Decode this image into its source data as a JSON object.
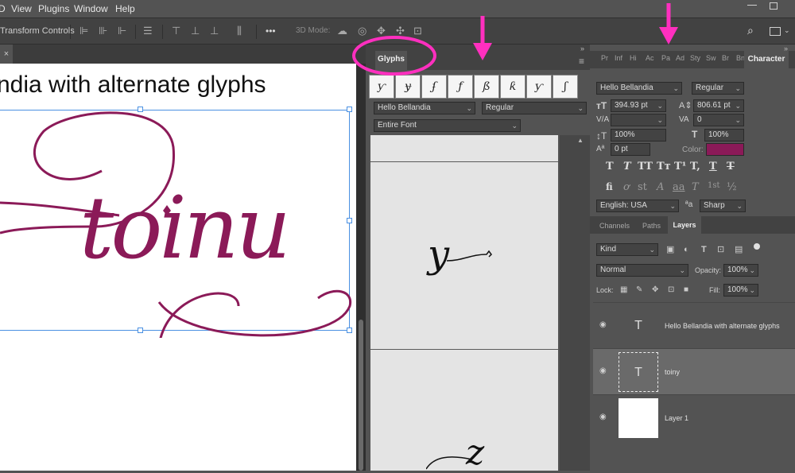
{
  "menubar": {
    "items": [
      "View",
      "Plugins",
      "Window",
      "Help"
    ],
    "partial": "D"
  },
  "options_bar": {
    "label": "Transform Controls",
    "more": "•••",
    "mode_label": "3D Mode:"
  },
  "document": {
    "tab_close": "×",
    "title_text": "ndia with alternate glyphs",
    "art_text": "toinu"
  },
  "glyphs": {
    "tab_label": "Glyphs",
    "recent": [
      "ƴ",
      "ɏ",
      "ʄ",
      "ƒ",
      "ß",
      "ƙ",
      "ƴ",
      "ʃ"
    ],
    "font": "Hello Bellandia",
    "style": "Regular",
    "filter": "Entire Font",
    "glyph_1": "y",
    "glyph_2": "z"
  },
  "character": {
    "tabs_collapsed": [
      "Pr",
      "Inf",
      "Hi",
      "Ac",
      "Pa",
      "Ad",
      "Sty",
      "Sw",
      "Br",
      "Bn"
    ],
    "tab_label": "Character",
    "font": "Hello Bellandia",
    "style": "Regular",
    "size": "394.93 pt",
    "leading": "806.61 pt",
    "tracking": "0",
    "vscale": "100%",
    "hscale": "100%",
    "baseline": "0 pt",
    "color_label": "Color:",
    "color": "#8b1a58",
    "formats": [
      "T",
      "T",
      "TT",
      "Tт",
      "T¹",
      "T,",
      "T",
      "T"
    ],
    "opentype": [
      "fi",
      "ơ",
      "st",
      "A",
      "aa",
      "T",
      "1st",
      "½"
    ],
    "language": "English: USA",
    "aa_icon": "ªa",
    "antialias": "Sharp"
  },
  "layers_panel": {
    "tabs": [
      "Channels",
      "Paths",
      "Layers"
    ],
    "kind": "Kind",
    "blend": "Normal",
    "opacity_label": "Opacity:",
    "opacity": "100%",
    "lock_label": "Lock:",
    "fill_label": "Fill:",
    "fill": "100%",
    "layers": [
      {
        "name": "Hello Bellandia with alternate glyphs",
        "thumb": "T"
      },
      {
        "name": "toiny",
        "thumb": "T"
      },
      {
        "name": "Layer 1",
        "thumb": ""
      }
    ]
  },
  "colors": {
    "accent_pink": "#ff2fbf",
    "art_color": "#8b1a58",
    "panel_bg": "#535353"
  }
}
